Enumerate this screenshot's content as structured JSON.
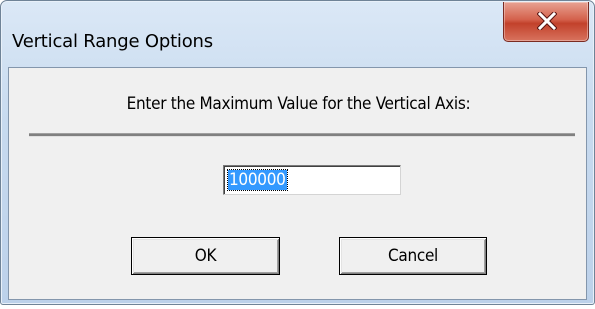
{
  "window": {
    "title": "Vertical Range Options",
    "close_glyph": "X"
  },
  "dialog": {
    "prompt": "Enter the Maximum Value for the Vertical Axis:",
    "value": "100000",
    "ok_label": "OK",
    "cancel_label": "Cancel"
  },
  "colors": {
    "title_bar": "#c7daef",
    "close_button": "#c2412b",
    "client_bg": "#f0f0f0",
    "selection": "#3399ff"
  },
  "icons": {
    "close": "close-icon"
  }
}
